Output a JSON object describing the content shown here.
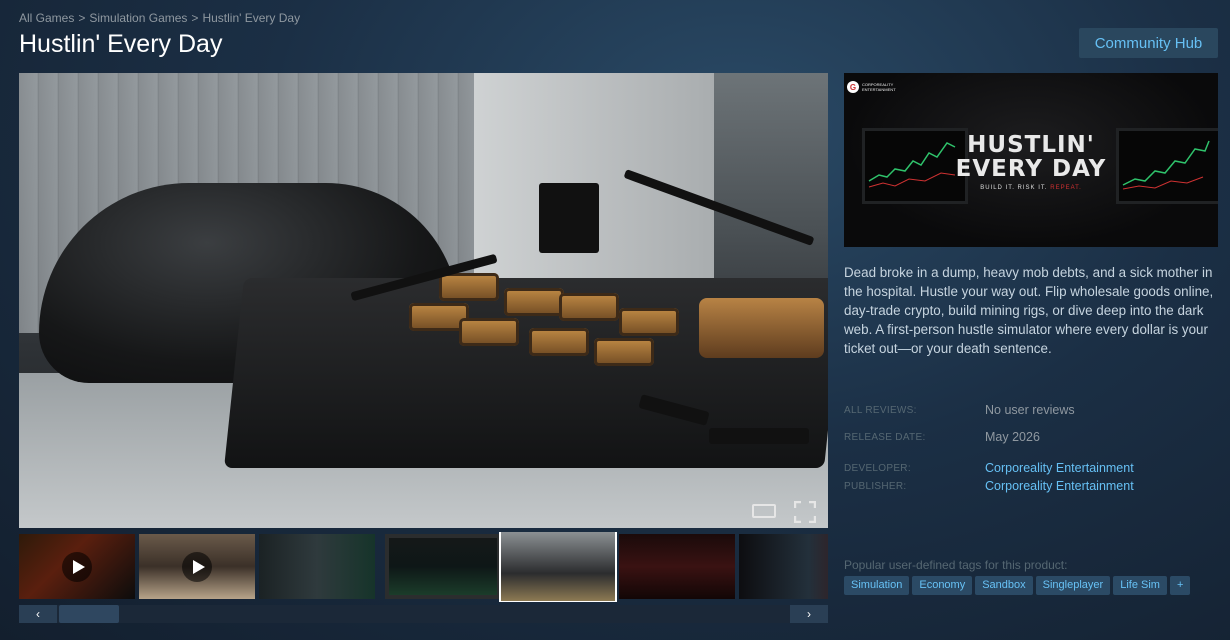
{
  "breadcrumb": {
    "items": [
      "All Games",
      "Simulation Games",
      "Hustlin' Every Day"
    ],
    "separator": ">"
  },
  "title": "Hustlin' Every Day",
  "community_hub_label": "Community Hub",
  "capsule": {
    "publisher_logo_text": "CORPOREALITY ENTERTAINMENT",
    "game_title": "HUSTLIN' EVERY DAY",
    "tagline_prefix": "BUILD IT. RISK IT.",
    "tagline_accent": "REPEAT."
  },
  "description": "Dead broke in a dump, heavy mob debts, and a sick mother in the hospital. Hustle your way out. Flip wholesale goods online, day-trade crypto, build mining rigs, or dive deep into the dark web. A first-person hustle simulator where every dollar is your ticket out—or your death sentence.",
  "details": {
    "all_reviews_label": "ALL REVIEWS:",
    "all_reviews_value": "No user reviews",
    "release_label": "RELEASE DATE:",
    "release_value": "May 2026",
    "developer_label": "DEVELOPER:",
    "developer_value": "Corporeality Entertainment",
    "publisher_label": "PUBLISHER:",
    "publisher_value": "Corporeality Entertainment"
  },
  "tags": {
    "label": "Popular user-defined tags for this product:",
    "items": [
      "Simulation",
      "Economy",
      "Sandbox",
      "Singleplayer",
      "Life Sim",
      "+"
    ]
  },
  "thumbnails": [
    {
      "type": "video",
      "active": false
    },
    {
      "type": "video",
      "active": false
    },
    {
      "type": "image",
      "active": false
    },
    {
      "type": "image",
      "active": false
    },
    {
      "type": "image",
      "active": true
    },
    {
      "type": "image",
      "active": false
    },
    {
      "type": "image",
      "active": false
    }
  ],
  "icons": {
    "scroll_left": "‹",
    "scroll_right": "›",
    "widescreen": "widescreen-icon",
    "fullscreen": "fullscreen-icon"
  }
}
